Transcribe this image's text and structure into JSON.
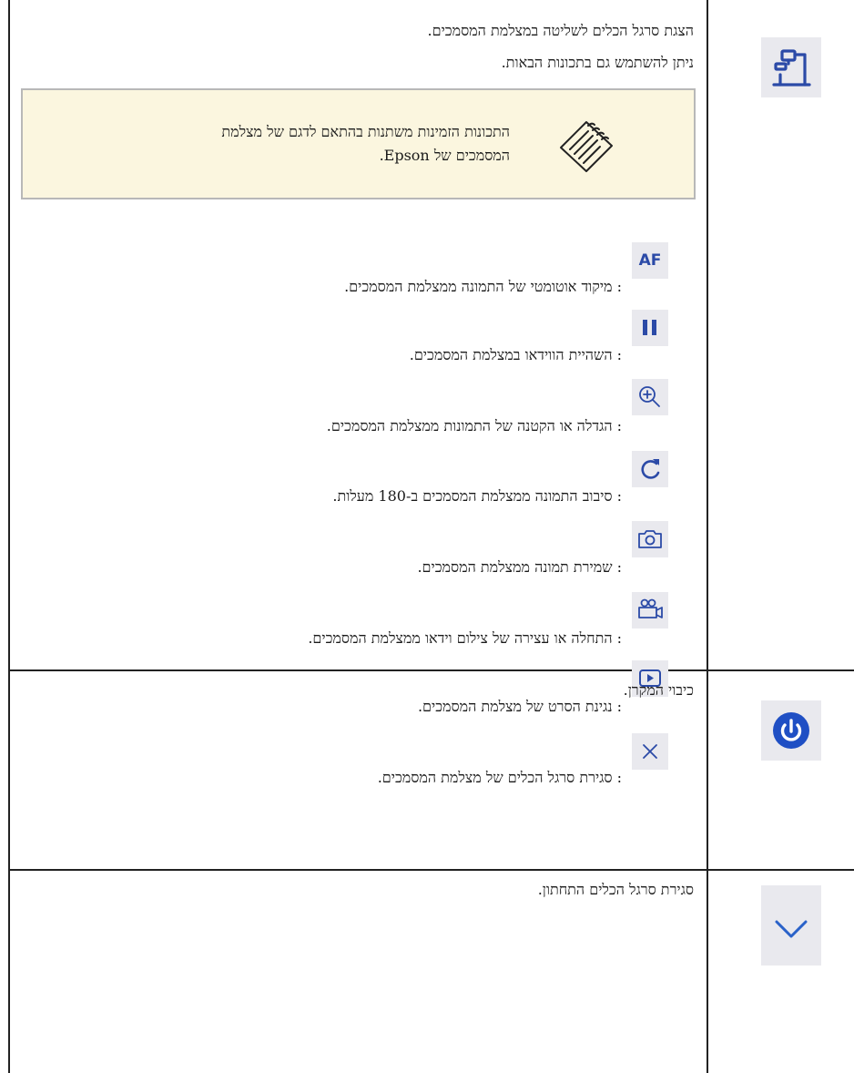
{
  "section_document_camera": {
    "line1": "הצגת סרגל הכלים לשליטה במצלמת המסמכים.",
    "line2": "ניתן להשתמש גם בתכונות הבאות.",
    "icon": "document-camera-icon",
    "note": {
      "icon": "note-pad-icon",
      "line1": "התכונות הזמינות משתנות בהתאם לדגם של מצלמת",
      "line2": "המסמכים של Epson."
    },
    "features": [
      {
        "icon": "autofocus-icon",
        "label": "AF",
        "text": ": מיקוד אוטומטי של התמונה ממצלמת המסמכים."
      },
      {
        "icon": "pause-icon",
        "text": ": השהיית הווידאו במצלמת המסמכים."
      },
      {
        "icon": "zoom-in-icon",
        "text": ": הגדלה או הקטנה של התמונות ממצלמת המסמכים."
      },
      {
        "icon": "rotate-icon",
        "text": ": סיבוב התמונה ממצלמת המסמכים ב-180 מעלות."
      },
      {
        "icon": "camera-icon",
        "text": ": שמירת תמונה ממצלמת המסמכים."
      },
      {
        "icon": "video-record-icon",
        "text": ": התחלה או עצירה של צילום וידאו ממצלמת המסמכים."
      },
      {
        "icon": "play-icon",
        "text": ": נגינת הסרט של מצלמת המסמכים."
      },
      {
        "icon": "close-icon",
        "text": ": סגירת סרגל הכלים של מצלמת המסמכים."
      }
    ]
  },
  "section_power": {
    "icon": "power-icon",
    "text": "כיבוי המקרן.",
    "accent": "#1f4fc4"
  },
  "section_close_toolbar": {
    "icon": "chevron-down-icon",
    "text": "סגירת סרגל הכלים התחתון.",
    "accent": "#2a62c9"
  },
  "colors": {
    "icon_bg": "#e9e9ee",
    "icon_blue": "#2b4aa7",
    "note_bg": "#fbf6df"
  }
}
